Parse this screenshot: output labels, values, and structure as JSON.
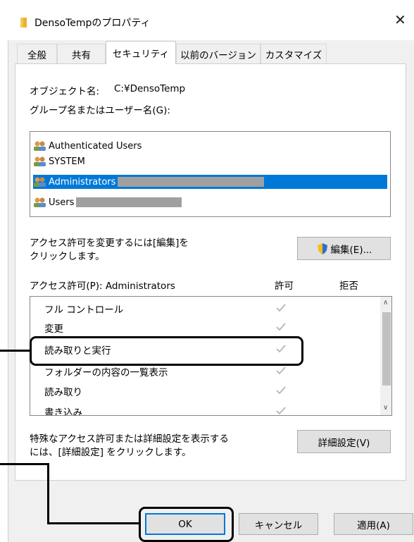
{
  "window": {
    "title": "DensoTempのプロパティ"
  },
  "tabs": [
    {
      "label": "全般"
    },
    {
      "label": "共有"
    },
    {
      "label": "セキュリティ"
    },
    {
      "label": "以前のバージョン"
    },
    {
      "label": "カスタマイズ"
    }
  ],
  "security": {
    "object_label": "オブジェクト名:",
    "object_value": "C:¥DensoTemp",
    "group_label": "グループ名またはユーザー名(G):",
    "users": [
      {
        "name": "Authenticated Users"
      },
      {
        "name": "SYSTEM"
      },
      {
        "name": "Administrators"
      },
      {
        "name": "Users"
      }
    ],
    "edit_hint_line1": "アクセス許可を変更するには[編集]を",
    "edit_hint_line2": "クリックします。",
    "edit_button": "編集(E)...",
    "perm_header": "アクセス許可(P): Administrators",
    "allow_header": "許可",
    "deny_header": "拒否",
    "permissions": [
      {
        "name": "フル コントロール"
      },
      {
        "name": "変更"
      },
      {
        "name": "読み取りと実行"
      },
      {
        "name": "フォルダーの内容の一覧表示"
      },
      {
        "name": "読み取り"
      },
      {
        "name": "書き込み"
      }
    ],
    "advanced_hint_line1": "特殊なアクセス許可または詳細設定を表示する",
    "advanced_hint_line2": "には、[詳細設定] をクリックします。",
    "advanced_button": "詳細設定(V)"
  },
  "footer": {
    "ok": "OK",
    "cancel": "キャンセル",
    "apply": "適用(A)"
  },
  "colors": {
    "selection": "#0078d7",
    "accent_border": "#0078d7",
    "callout": "#000000",
    "check": "#b5b5b5"
  }
}
